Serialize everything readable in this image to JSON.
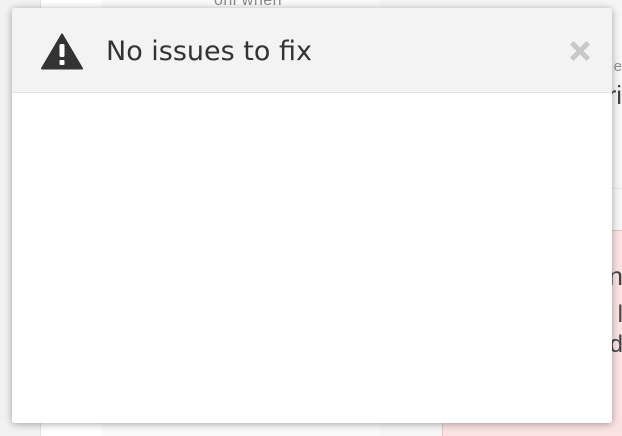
{
  "dialog": {
    "title": "No issues to fix",
    "icons": {
      "header": "warning-icon",
      "close": "close-icon"
    }
  },
  "background_fragments": {
    "top_text": "onl when",
    "right_e": "e",
    "right_ri": "ri",
    "red_card_n": "n",
    "red_card_l": "l",
    "red_card_d": "d"
  },
  "colors": {
    "dialog_header_bg": "#f3f3f3",
    "title_text": "#333333",
    "icon": "#333333",
    "close_icon": "#c8c8c8",
    "red_card_bg": "#fbe3e3"
  }
}
